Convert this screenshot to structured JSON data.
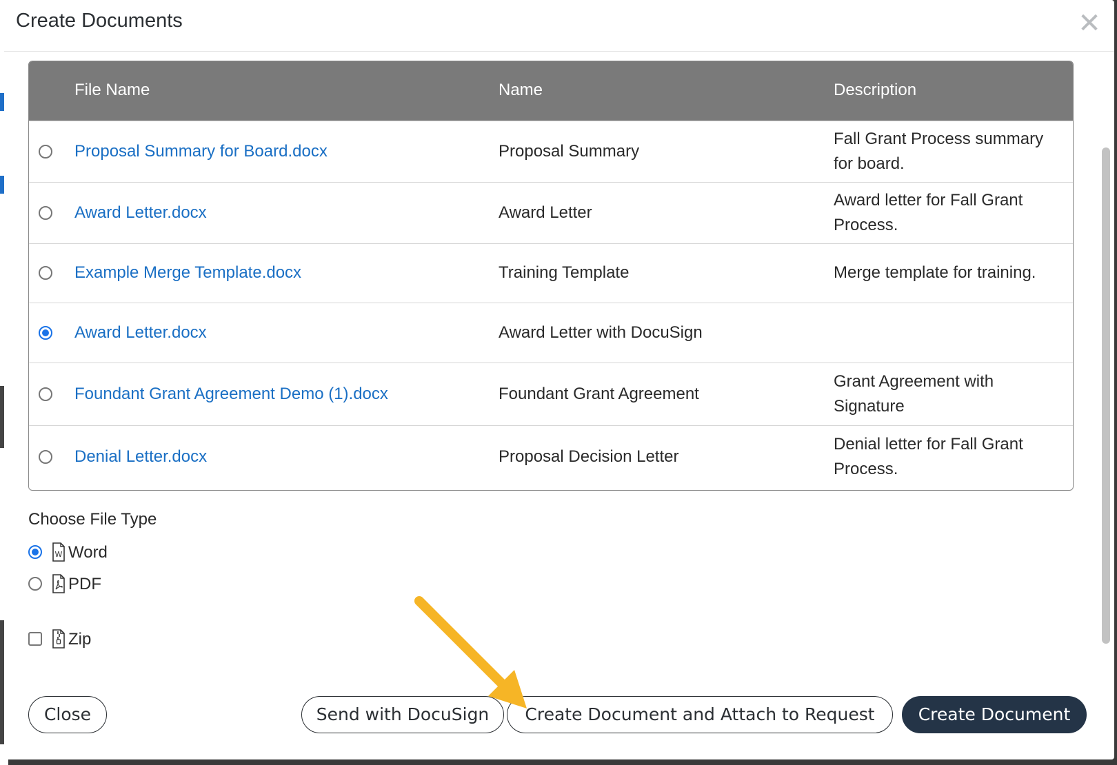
{
  "modal": {
    "title": "Create Documents",
    "close_icon": "close-x-icon"
  },
  "table": {
    "columns": [
      "File Name",
      "Name",
      "Description"
    ],
    "rows": [
      {
        "file": "Proposal Summary for Board.docx",
        "name": "Proposal Summary",
        "description": "Fall Grant Process summary for board.",
        "selected": false
      },
      {
        "file": "Award Letter.docx",
        "name": "Award Letter",
        "description": "Award letter for Fall Grant Process.",
        "selected": false
      },
      {
        "file": "Example Merge Template.docx",
        "name": "Training Template",
        "description": "Merge template for training.",
        "selected": false
      },
      {
        "file": "Award Letter.docx",
        "name": "Award Letter with DocuSign",
        "description": "",
        "selected": true
      },
      {
        "file": "Foundant Grant Agreement Demo (1).docx",
        "name": "Foundant Grant Agreement",
        "description": "Grant Agreement with Signature",
        "selected": false
      },
      {
        "file": "Denial Letter.docx",
        "name": "Proposal Decision Letter",
        "description": "Denial letter for Fall Grant Process.",
        "selected": false
      }
    ]
  },
  "file_type": {
    "label": "Choose File Type",
    "options": [
      {
        "label": "Word",
        "icon": "word-file-icon",
        "selected": true
      },
      {
        "label": "PDF",
        "icon": "pdf-file-icon",
        "selected": false
      }
    ],
    "zip": {
      "label": "Zip",
      "icon": "zip-file-icon",
      "checked": false
    }
  },
  "buttons": {
    "close": "Close",
    "send_docusign": "Send with DocuSign",
    "create_attach": "Create Document and Attach to Request",
    "create": "Create Document"
  },
  "colors": {
    "link": "#1a6fc4",
    "header_bg": "#7a7a7a",
    "primary_button": "#243447",
    "radio_selected": "#1a73e8",
    "annotation_arrow": "#f6b526"
  }
}
